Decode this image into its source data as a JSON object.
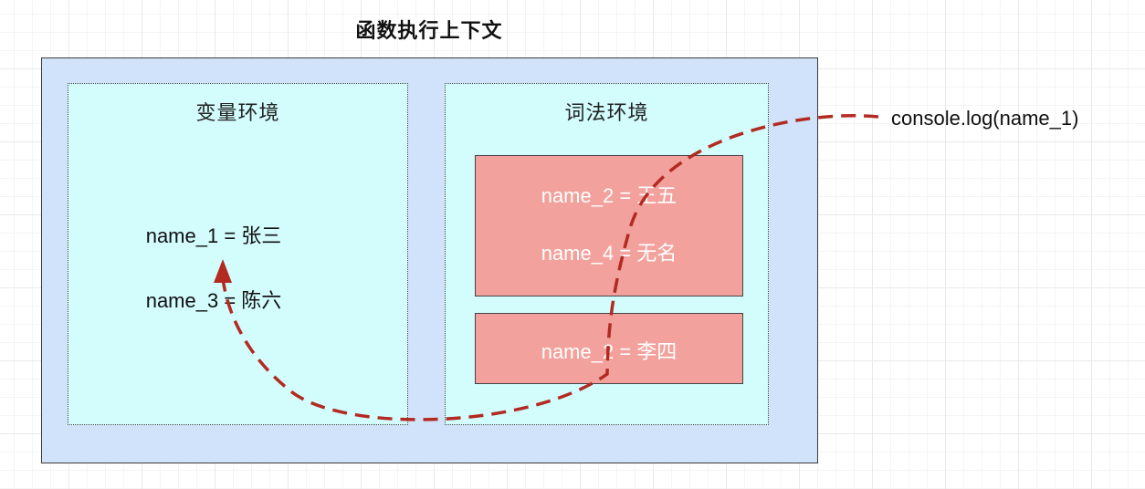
{
  "diagram": {
    "title": "函数执行上下文",
    "variable_env": {
      "title": "变量环境",
      "entries": [
        "name_1 = 张三",
        "name_3 = 陈六"
      ]
    },
    "lexical_env": {
      "title": "词法环境",
      "block_inner": [
        "name_2 = 王五",
        "name_4 = 无名"
      ],
      "block_outer": [
        "name_2 = 李四"
      ]
    },
    "lookup_call": "console.log(name_1)",
    "colors": {
      "context_fill": "#d1e3fb",
      "env_fill": "#d3fcfd",
      "block_fill": "#f2a19c",
      "arrow": "#b22a22"
    }
  }
}
